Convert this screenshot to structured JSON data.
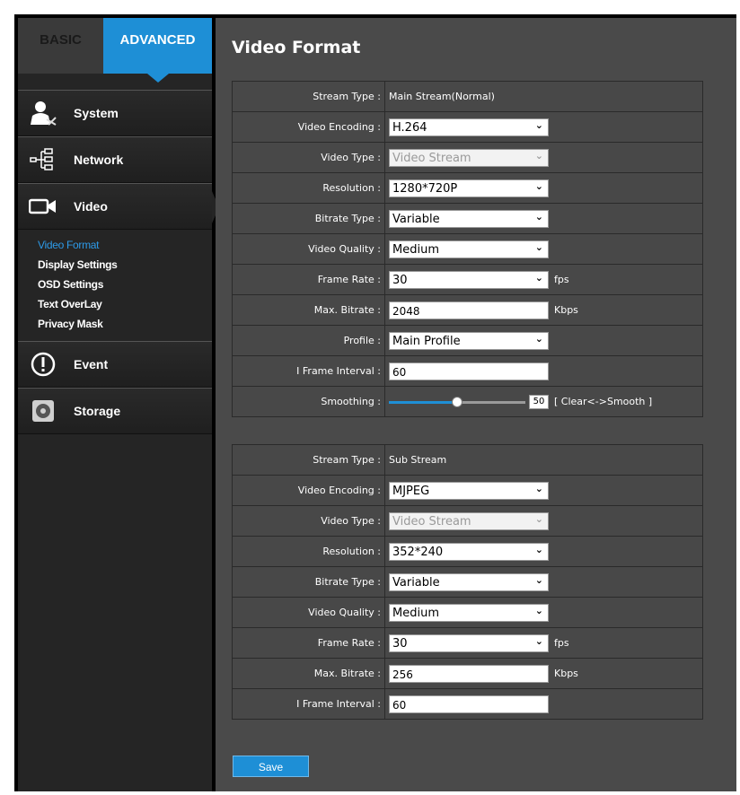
{
  "tabs": {
    "basic": "BASIC",
    "advanced": "ADVANCED"
  },
  "menu": {
    "system": {
      "label": "System",
      "icon": "system-admin-icon"
    },
    "network": {
      "label": "Network",
      "icon": "network-icon"
    },
    "video": {
      "label": "Video",
      "icon": "video-camera-icon"
    },
    "video_sub": [
      "Video Format",
      "Display Settings",
      "OSD Settings",
      "Text OverLay",
      "Privacy Mask"
    ],
    "event": {
      "label": "Event",
      "icon": "alert-icon"
    },
    "storage": {
      "label": "Storage",
      "icon": "storage-disk-icon"
    }
  },
  "page_title": "Video Format",
  "main_stream": {
    "stream_type_label": "Stream Type :",
    "stream_type_value": "Main Stream(Normal)",
    "video_encoding_label": "Video Encoding :",
    "video_encoding_value": "H.264",
    "video_type_label": "Video Type :",
    "video_type_value": "Video Stream",
    "resolution_label": "Resolution :",
    "resolution_value": "1280*720P",
    "bitrate_type_label": "Bitrate Type :",
    "bitrate_type_value": "Variable",
    "video_quality_label": "Video Quality :",
    "video_quality_value": "Medium",
    "frame_rate_label": "Frame Rate :",
    "frame_rate_value": "30",
    "frame_rate_unit": "fps",
    "max_bitrate_label": "Max. Bitrate :",
    "max_bitrate_value": "2048",
    "max_bitrate_unit": "Kbps",
    "profile_label": "Profile :",
    "profile_value": "Main Profile",
    "iframe_label": "I Frame Interval :",
    "iframe_value": "60",
    "smoothing_label": "Smoothing :",
    "smoothing_value": "50",
    "smoothing_hint": "[ Clear<->Smooth ]"
  },
  "sub_stream": {
    "stream_type_label": "Stream Type :",
    "stream_type_value": "Sub Stream",
    "video_encoding_label": "Video Encoding :",
    "video_encoding_value": "MJPEG",
    "video_type_label": "Video Type :",
    "video_type_value": "Video Stream",
    "resolution_label": "Resolution :",
    "resolution_value": "352*240",
    "bitrate_type_label": "Bitrate Type :",
    "bitrate_type_value": "Variable",
    "video_quality_label": "Video Quality :",
    "video_quality_value": "Medium",
    "frame_rate_label": "Frame Rate :",
    "frame_rate_value": "30",
    "frame_rate_unit": "fps",
    "max_bitrate_label": "Max. Bitrate :",
    "max_bitrate_value": "256",
    "max_bitrate_unit": "Kbps",
    "iframe_label": "I Frame Interval :",
    "iframe_value": "60"
  },
  "save_label": "Save",
  "colors": {
    "accent": "#1e8fd6",
    "panel": "#4a4a4a",
    "sidebar": "#252525"
  }
}
